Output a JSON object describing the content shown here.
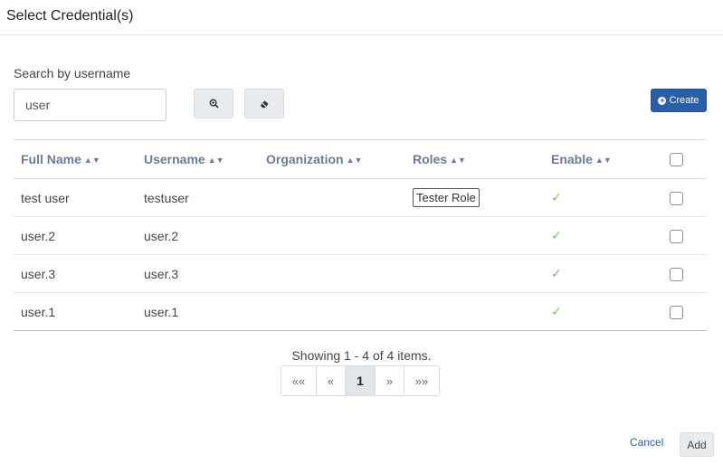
{
  "dialog": {
    "title": "Select Credential(s)"
  },
  "search": {
    "label": "Search by username",
    "value": "user",
    "search_icon": "magnifier-zoom-icon",
    "clear_icon": "eraser-icon"
  },
  "create_button": {
    "label": "Create",
    "icon": "plus-circle-icon"
  },
  "table": {
    "columns": [
      {
        "label": "Full Name",
        "sortable": true
      },
      {
        "label": "Username",
        "sortable": true
      },
      {
        "label": "Organization",
        "sortable": true
      },
      {
        "label": "Roles",
        "sortable": true
      },
      {
        "label": "Enable",
        "sortable": true
      }
    ],
    "rows": [
      {
        "full_name": "test user",
        "username": "testuser",
        "organization": "",
        "roles": "Tester Role",
        "enabled": true
      },
      {
        "full_name": "user.2",
        "username": "user.2",
        "organization": "",
        "roles": "",
        "enabled": true
      },
      {
        "full_name": "user.3",
        "username": "user.3",
        "organization": "",
        "roles": "",
        "enabled": true
      },
      {
        "full_name": "user.1",
        "username": "user.1",
        "organization": "",
        "roles": "",
        "enabled": true
      }
    ]
  },
  "pagination": {
    "summary": "Showing 1 - 4 of 4 items.",
    "first": "««",
    "prev": "«",
    "current": "1",
    "next": "»",
    "last": "»»"
  },
  "footer": {
    "cancel": "Cancel",
    "add": "Add"
  },
  "colors": {
    "primary": "#2a5ea6",
    "check": "#7cbf6a",
    "header_text": "#6b7a99"
  }
}
